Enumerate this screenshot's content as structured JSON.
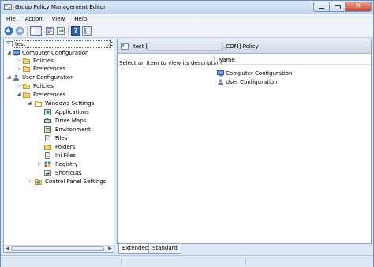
{
  "window": {
    "title": "Group Policy Management Editor",
    "colors": {
      "titlebar": "#c2d6ef",
      "close": "#c8472f",
      "frame": "#dfe9f5"
    }
  },
  "menu": [
    "File",
    "Action",
    "View",
    "Help"
  ],
  "toolbar": {
    "icons": [
      "back-arrow-icon",
      "forward-arrow-icon",
      "console-tree-icon",
      "properties-icon",
      "export-list-icon",
      "help-icon",
      "show-hide-icon"
    ]
  },
  "tree": {
    "root": "test [",
    "root_suffix": ".C",
    "items": [
      {
        "label": "Computer Configuration",
        "icon": "computer-icon"
      },
      {
        "label": "Policies",
        "icon": "folder-icon"
      },
      {
        "label": "Preferences",
        "icon": "folder-icon"
      },
      {
        "label": "User Configuration",
        "icon": "user-icon"
      },
      {
        "label": "Policies",
        "icon": "folder-icon"
      },
      {
        "label": "Preferences",
        "icon": "folder-icon"
      },
      {
        "label": "Windows Settings",
        "icon": "folder-icon"
      },
      {
        "label": "Applications",
        "icon": "applications-icon"
      },
      {
        "label": "Drive Maps",
        "icon": "drive-maps-icon"
      },
      {
        "label": "Environment",
        "icon": "environment-icon"
      },
      {
        "label": "Files",
        "icon": "files-icon"
      },
      {
        "label": "Folders",
        "icon": "folders-icon"
      },
      {
        "label": "Ini Files",
        "icon": "ini-files-icon"
      },
      {
        "label": "Registry",
        "icon": "registry-icon"
      },
      {
        "label": "Shortcuts",
        "icon": "shortcuts-icon"
      },
      {
        "label": "Control Panel Settings",
        "icon": "control-panel-icon"
      }
    ]
  },
  "details": {
    "title_prefix": "test [",
    "title_suffix": ".COM] Policy",
    "description": "Select an item to view its description.",
    "column_name": "Name",
    "rows": [
      "Computer Configuration",
      "User Configuration"
    ]
  },
  "tabs": [
    "Extended",
    "Standard"
  ]
}
